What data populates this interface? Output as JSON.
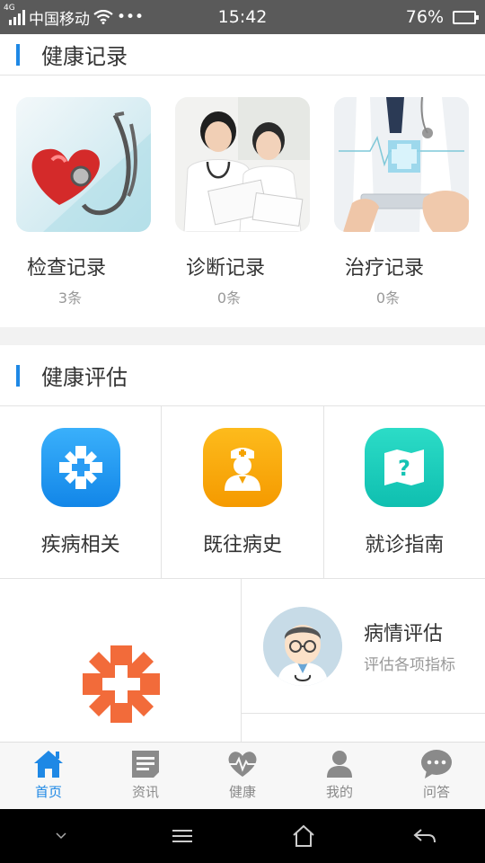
{
  "status_bar": {
    "network": "4G",
    "carrier": "中国移动",
    "more": "•••",
    "time": "15:42",
    "battery": "76%",
    "battery_level": 0.76
  },
  "health_records": {
    "title": "健康记录",
    "items": [
      {
        "name": "检查记录",
        "count": "3条",
        "image": "heart-stethoscope-image"
      },
      {
        "name": "诊断记录",
        "count": "0条",
        "image": "doctors-reviewing-image"
      },
      {
        "name": "治疗记录",
        "count": "0条",
        "image": "tablet-medical-cross-image"
      }
    ]
  },
  "health_assessment": {
    "title": "健康评估",
    "grid": [
      {
        "label": "疾病相关",
        "icon": "medical-cross-icon",
        "color": "#1e9bf0"
      },
      {
        "label": "既往病史",
        "icon": "nurse-icon",
        "color": "#f7a400"
      },
      {
        "label": "就诊指南",
        "icon": "map-question-icon",
        "color": "#17c9b8"
      }
    ],
    "assess_item": {
      "title": "病情评估",
      "subtitle": "评估各项指标"
    }
  },
  "tabbar": {
    "items": [
      {
        "label": "首页",
        "icon": "home-icon",
        "active": true
      },
      {
        "label": "资讯",
        "icon": "news-icon",
        "active": false
      },
      {
        "label": "健康",
        "icon": "heart-pulse-icon",
        "active": false
      },
      {
        "label": "我的",
        "icon": "user-icon",
        "active": false
      },
      {
        "label": "问答",
        "icon": "chat-icon",
        "active": false
      }
    ]
  },
  "colors": {
    "accent": "#1e88e5",
    "inactive": "#8a8a8a"
  }
}
